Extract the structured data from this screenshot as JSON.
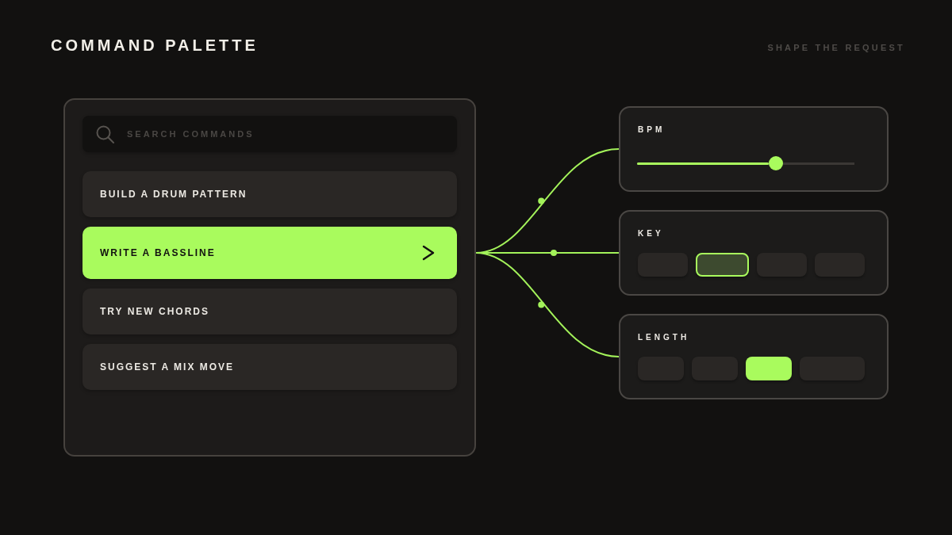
{
  "header": {
    "title": "COMMAND PALETTE",
    "tagline": "SHAPE THE REQUEST"
  },
  "palette": {
    "search": {
      "placeholder": "SEARCH COMMANDS"
    },
    "commands": [
      {
        "label": "BUILD A DRUM PATTERN",
        "selected": false
      },
      {
        "label": "WRITE A BASSLINE",
        "selected": true
      },
      {
        "label": "TRY NEW CHORDS",
        "selected": false
      },
      {
        "label": "SUGGEST A MIX MOVE",
        "selected": false
      }
    ]
  },
  "params": [
    {
      "kind": "slider",
      "label": "BPM",
      "level": 0.64
    },
    {
      "kind": "chips",
      "label": "KEY",
      "options": [
        {
          "selected": false
        },
        {
          "selected": true
        },
        {
          "selected": false
        },
        {
          "selected": false
        }
      ]
    },
    {
      "kind": "segments",
      "label": "LENGTH",
      "options": [
        {
          "selected": false
        },
        {
          "selected": false
        },
        {
          "selected": true
        },
        {
          "selected": false
        }
      ]
    }
  ]
}
